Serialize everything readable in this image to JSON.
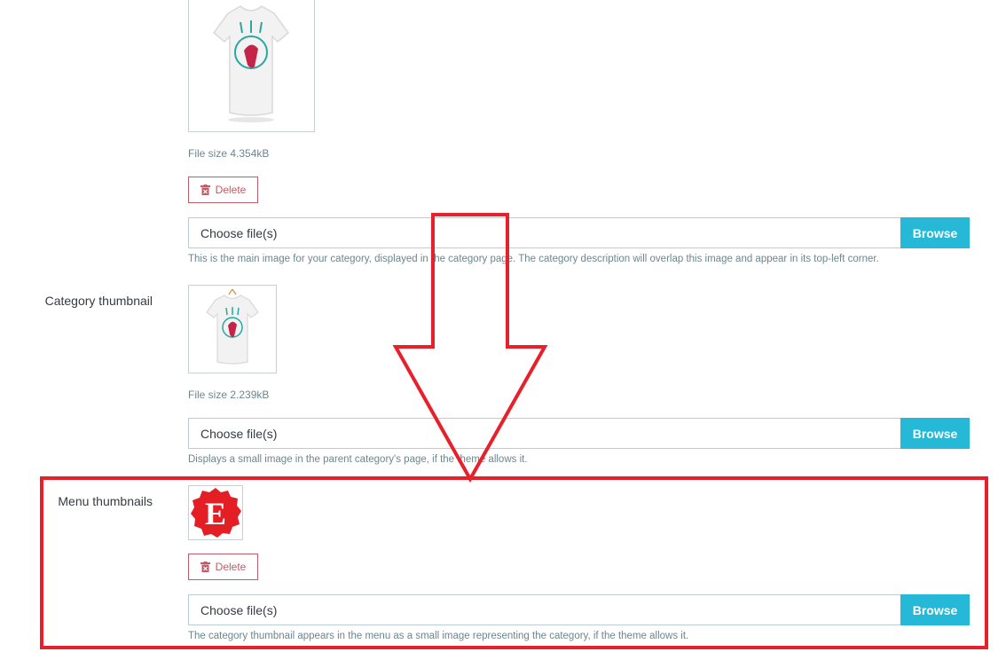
{
  "main_image": {
    "file_size": "File size 4.354kB",
    "delete_label": "Delete",
    "file_placeholder": "Choose file(s)",
    "browse_label": "Browse",
    "help": "This is the main image for your category, displayed in the category page. The category description will overlap this image and appear in its top-left corner."
  },
  "category_thumbnail": {
    "label": "Category thumbnail",
    "file_size": "File size 2.239kB",
    "file_placeholder": "Choose file(s)",
    "browse_label": "Browse",
    "help": "Displays a small image in the parent category's page, if the theme allows it."
  },
  "menu_thumbnails": {
    "label": "Menu thumbnails",
    "logo_letter": "E",
    "delete_label": "Delete",
    "file_placeholder": "Choose file(s)",
    "browse_label": "Browse",
    "help": "The category thumbnail appears in the menu as a small image representing the category, if the theme allows it."
  },
  "colors": {
    "accent": "#25b9d7",
    "danger": "#c05c67",
    "annotation": "#e8202b"
  }
}
